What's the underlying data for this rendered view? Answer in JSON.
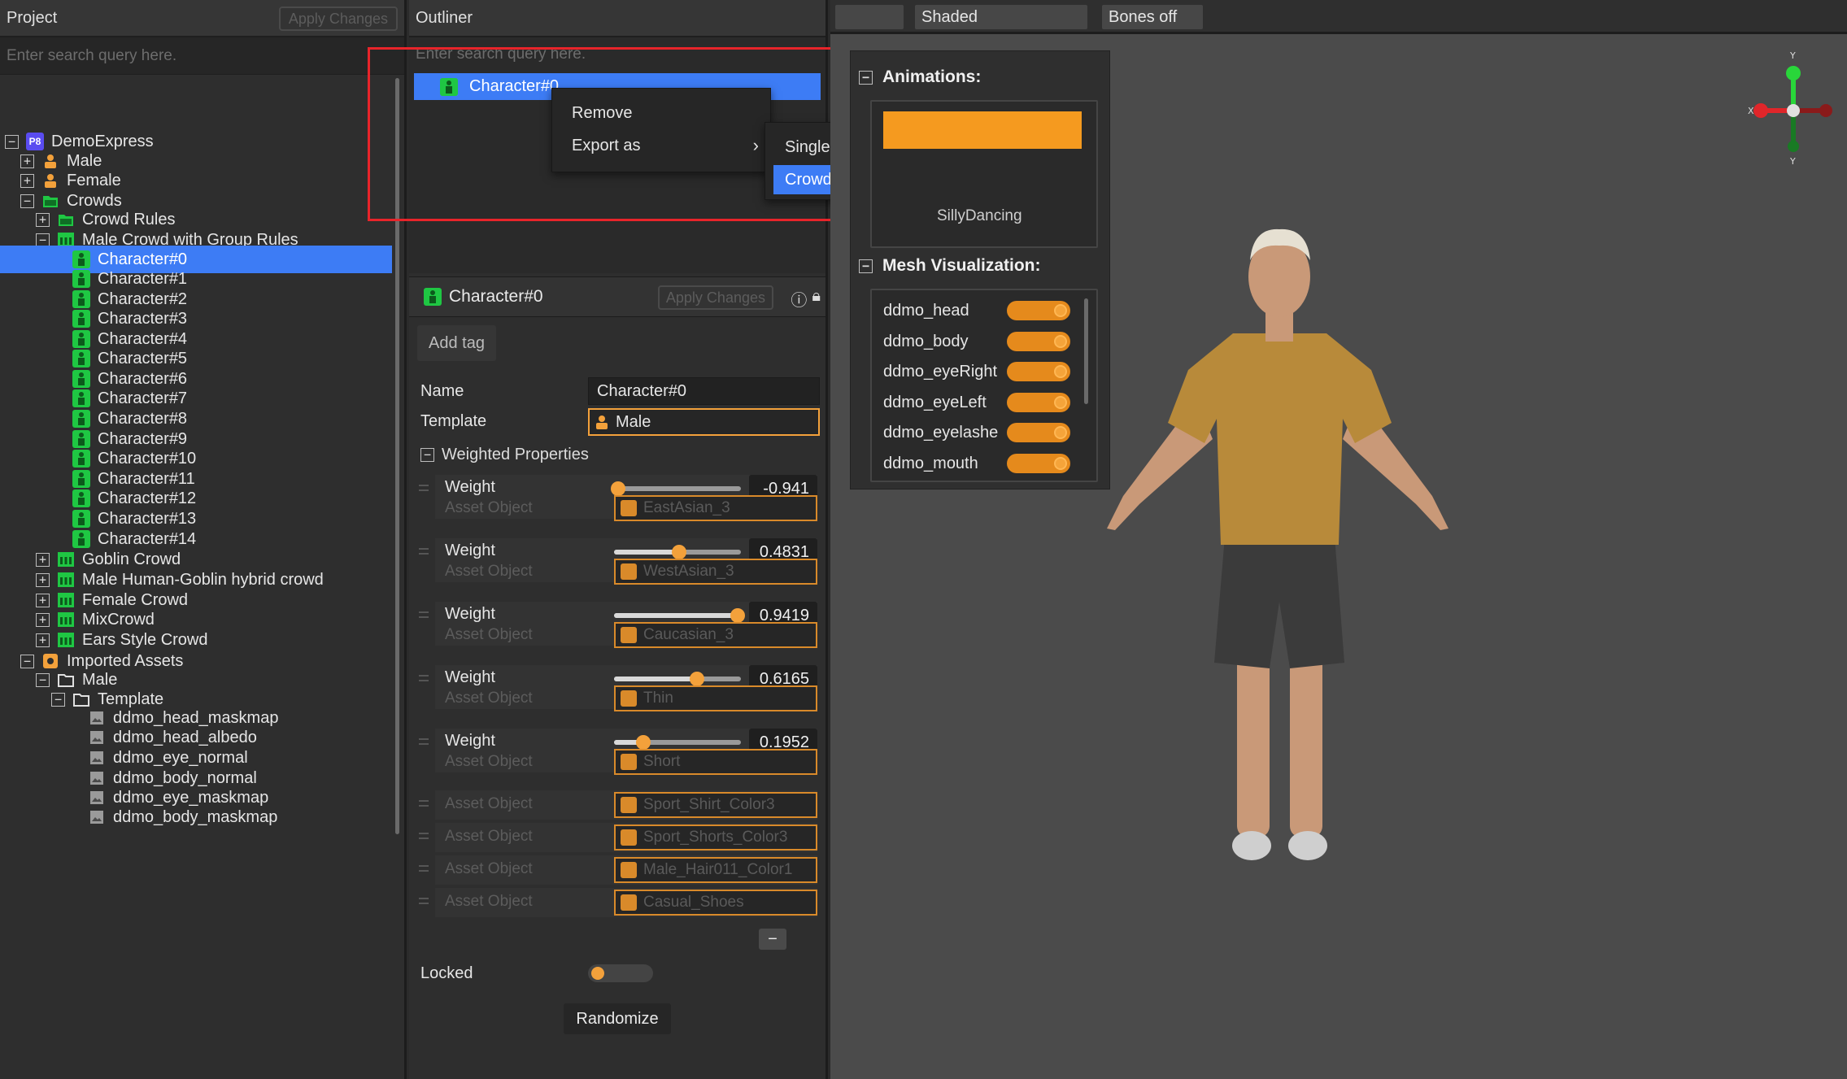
{
  "project": {
    "title": "Project",
    "apply_label": "Apply Changes",
    "search_placeholder": "Enter search query here.",
    "tree": [
      {
        "label": "DemoExpress",
        "level": 0,
        "expander": "−",
        "icon": "p8-project-icon"
      },
      {
        "label": "Male",
        "level": 1,
        "expander": "+",
        "icon": "person-icon"
      },
      {
        "label": "Female",
        "level": 1,
        "expander": "+",
        "icon": "person-icon"
      },
      {
        "label": "Crowds",
        "level": 1,
        "expander": "−",
        "icon": "folder-green-icon"
      },
      {
        "label": "Crowd Rules",
        "level": 2,
        "expander": "+",
        "icon": "folder-green-icon"
      },
      {
        "label": "Male Crowd with Group Rules",
        "level": 2,
        "expander": "−",
        "icon": "crowd-icon"
      },
      {
        "label": "Character#0",
        "level": 3,
        "expander": "",
        "icon": "character-icon",
        "selected": true
      },
      {
        "label": "Character#1",
        "level": 3,
        "expander": "",
        "icon": "character-icon"
      },
      {
        "label": "Character#2",
        "level": 3,
        "expander": "",
        "icon": "character-icon"
      },
      {
        "label": "Character#3",
        "level": 3,
        "expander": "",
        "icon": "character-icon"
      },
      {
        "label": "Character#4",
        "level": 3,
        "expander": "",
        "icon": "character-icon"
      },
      {
        "label": "Character#5",
        "level": 3,
        "expander": "",
        "icon": "character-icon"
      },
      {
        "label": "Character#6",
        "level": 3,
        "expander": "",
        "icon": "character-icon"
      },
      {
        "label": "Character#7",
        "level": 3,
        "expander": "",
        "icon": "character-icon"
      },
      {
        "label": "Character#8",
        "level": 3,
        "expander": "",
        "icon": "character-icon"
      },
      {
        "label": "Character#9",
        "level": 3,
        "expander": "",
        "icon": "character-icon"
      },
      {
        "label": "Character#10",
        "level": 3,
        "expander": "",
        "icon": "character-icon"
      },
      {
        "label": "Character#11",
        "level": 3,
        "expander": "",
        "icon": "character-icon"
      },
      {
        "label": "Character#12",
        "level": 3,
        "expander": "",
        "icon": "character-icon"
      },
      {
        "label": "Character#13",
        "level": 3,
        "expander": "",
        "icon": "character-icon"
      },
      {
        "label": "Character#14",
        "level": 3,
        "expander": "",
        "icon": "character-icon"
      },
      {
        "label": "Goblin Crowd",
        "level": 2,
        "expander": "+",
        "icon": "crowd-icon"
      },
      {
        "label": "Male Human-Goblin hybrid crowd",
        "level": 2,
        "expander": "+",
        "icon": "crowd-icon"
      },
      {
        "label": "Female Crowd",
        "level": 2,
        "expander": "+",
        "icon": "crowd-icon"
      },
      {
        "label": "MixCrowd",
        "level": 2,
        "expander": "+",
        "icon": "crowd-icon"
      },
      {
        "label": "Ears Style Crowd",
        "level": 2,
        "expander": "+",
        "icon": "crowd-icon"
      },
      {
        "label": "Imported Assets",
        "level": 1,
        "expander": "−",
        "icon": "imported-icon"
      },
      {
        "label": "Male",
        "level": 2,
        "expander": "−",
        "icon": "folder-icon"
      },
      {
        "label": "Template",
        "level": 3,
        "expander": "−",
        "icon": "folder-icon"
      },
      {
        "label": "ddmo_head_maskmap",
        "level": 4,
        "expander": "",
        "icon": "image-icon"
      },
      {
        "label": "ddmo_head_albedo",
        "level": 4,
        "expander": "",
        "icon": "image-icon"
      },
      {
        "label": "ddmo_eye_normal",
        "level": 4,
        "expander": "",
        "icon": "image-icon"
      },
      {
        "label": "ddmo_body_normal",
        "level": 4,
        "expander": "",
        "icon": "image-icon"
      },
      {
        "label": "ddmo_eye_maskmap",
        "level": 4,
        "expander": "",
        "icon": "image-icon"
      },
      {
        "label": "ddmo_body_maskmap",
        "level": 4,
        "expander": "",
        "icon": "image-icon"
      }
    ]
  },
  "outliner": {
    "title": "Outliner",
    "search_placeholder": "Enter search query here.",
    "selected_item": "Character#0",
    "context_menu": {
      "items": [
        "Remove",
        "Export as"
      ],
      "submenu": [
        "Single",
        "Crowd"
      ],
      "highlighted": "Crowd"
    }
  },
  "inspector": {
    "title": "Character#0",
    "apply_label": "Apply Changes",
    "add_tag": "Add tag",
    "name_label": "Name",
    "name_value": "Character#0",
    "template_label": "Template",
    "template_value": "Male",
    "weighted_header": "Weighted Properties",
    "weight_label": "Weight",
    "asset_label": "Asset Object",
    "weights": [
      {
        "value": "-0.941",
        "fraction": 0.0,
        "asset": "EastAsian_3"
      },
      {
        "value": "0.4831",
        "fraction": 0.48,
        "asset": "WestAsian_3"
      },
      {
        "value": "0.9419",
        "fraction": 0.94,
        "asset": "Caucasian_3"
      },
      {
        "value": "0.6165",
        "fraction": 0.62,
        "asset": "Thin"
      },
      {
        "value": "0.1952",
        "fraction": 0.2,
        "asset": "Short"
      }
    ],
    "extra_assets": [
      "Sport_Shirt_Color3",
      "Sport_Shorts_Color3",
      "Male_Hair011_Color1",
      "Casual_Shoes"
    ],
    "minus_label": "−",
    "locked_label": "Locked",
    "randomize_label": "Randomize"
  },
  "viewport": {
    "toolbar": {
      "blank": "",
      "shading": "Shaded",
      "bones": "Bones off"
    },
    "animations_header": "Animations:",
    "animation_visible": "SillyDancing",
    "mesh_header": "Mesh Visualization:",
    "meshes": [
      "ddmo_head",
      "ddmo_body",
      "ddmo_eyeRight",
      "ddmo_eyeLeft",
      "ddmo_eyelashe",
      "ddmo_mouth"
    ],
    "gizmo": {
      "y": "Y",
      "x": "X",
      "y2": "Y"
    }
  },
  "colors": {
    "accent": "#3d7cf5",
    "orange": "#f3a13b",
    "highlight_box": "#e8242a",
    "character_green": "#1fc743"
  }
}
